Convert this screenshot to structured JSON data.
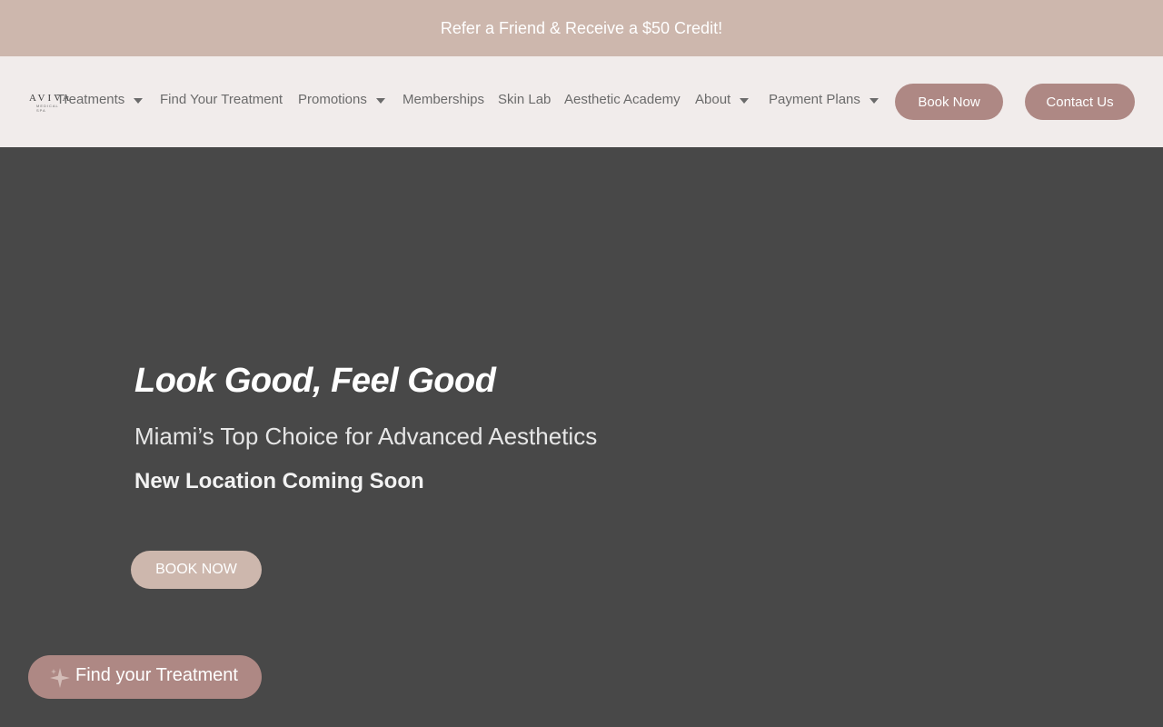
{
  "promo_bar": {
    "text": "Refer a Friend & Receive a $50 Credit!"
  },
  "logo": {
    "main": "AVIVA",
    "sub": "MEDICAL SPA"
  },
  "nav": {
    "items": [
      {
        "label": "Treatments",
        "has_dropdown": true
      },
      {
        "label": "Find Your Treatment",
        "has_dropdown": false
      },
      {
        "label": "Promotions",
        "has_dropdown": true
      },
      {
        "label": "Memberships",
        "has_dropdown": false
      },
      {
        "label": "Skin Lab",
        "has_dropdown": false
      },
      {
        "label": "Aesthetic Academy",
        "has_dropdown": false
      },
      {
        "label": "About",
        "has_dropdown": true
      },
      {
        "label": "Payment Plans",
        "has_dropdown": true
      }
    ],
    "book_now": "Book Now",
    "contact_us": "Contact Us"
  },
  "hero": {
    "title": "Look Good, Feel Good",
    "subtitle": "Miami’s Top Choice for Advanced Aesthetics",
    "note": "New Location Coming Soon",
    "cta": "BOOK NOW"
  },
  "finder": {
    "label": "Find your Treatment",
    "icon": "sparkle-icon"
  },
  "colors": {
    "promo_bg": "#cdb7ad",
    "header_bg": "#f1eceb",
    "hero_bg": "#484848",
    "accent": "#ae8884"
  }
}
